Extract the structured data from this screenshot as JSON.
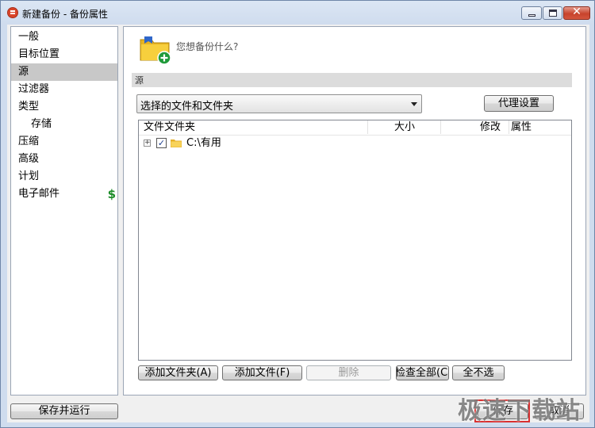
{
  "window": {
    "title": "新建备份 - 备份属性"
  },
  "sidebar": {
    "items": [
      {
        "label": "一般",
        "selected": false,
        "indent": false
      },
      {
        "label": "目标位置",
        "selected": false,
        "indent": false
      },
      {
        "label": "源",
        "selected": true,
        "indent": false
      },
      {
        "label": "过滤器",
        "selected": false,
        "indent": false
      },
      {
        "label": "类型",
        "selected": false,
        "indent": false
      },
      {
        "label": "存储",
        "selected": false,
        "indent": true
      },
      {
        "label": "压缩",
        "selected": false,
        "indent": false
      },
      {
        "label": "高级",
        "selected": false,
        "indent": false
      },
      {
        "label": "计划",
        "selected": false,
        "indent": false
      },
      {
        "label": "电子邮件",
        "selected": false,
        "indent": false,
        "badge": "$"
      }
    ]
  },
  "main": {
    "question": "您想备份什么?",
    "section_label": "源",
    "source_select": {
      "value": "选择的文件和文件夹"
    },
    "proxy_button": "代理设置",
    "list": {
      "columns": [
        "文件文件夹",
        "大小",
        "修改",
        "属性"
      ],
      "rows": [
        {
          "label": "C:\\有用",
          "checked": true,
          "expander": "+"
        }
      ]
    },
    "buttons": {
      "add_folder": "添加文件夹(A)",
      "add_file": "添加文件(F)",
      "delete": "删除",
      "check_all": "检查全部(C",
      "uncheck_all": "全不选"
    }
  },
  "footer": {
    "save_run": "保存并运行",
    "save": "保存",
    "cancel": "取消"
  },
  "watermark": "极速下载站",
  "colors": {
    "accent_green": "#1c8c28",
    "highlight_red": "#d93030",
    "selected_bg": "#c8c8c8"
  }
}
